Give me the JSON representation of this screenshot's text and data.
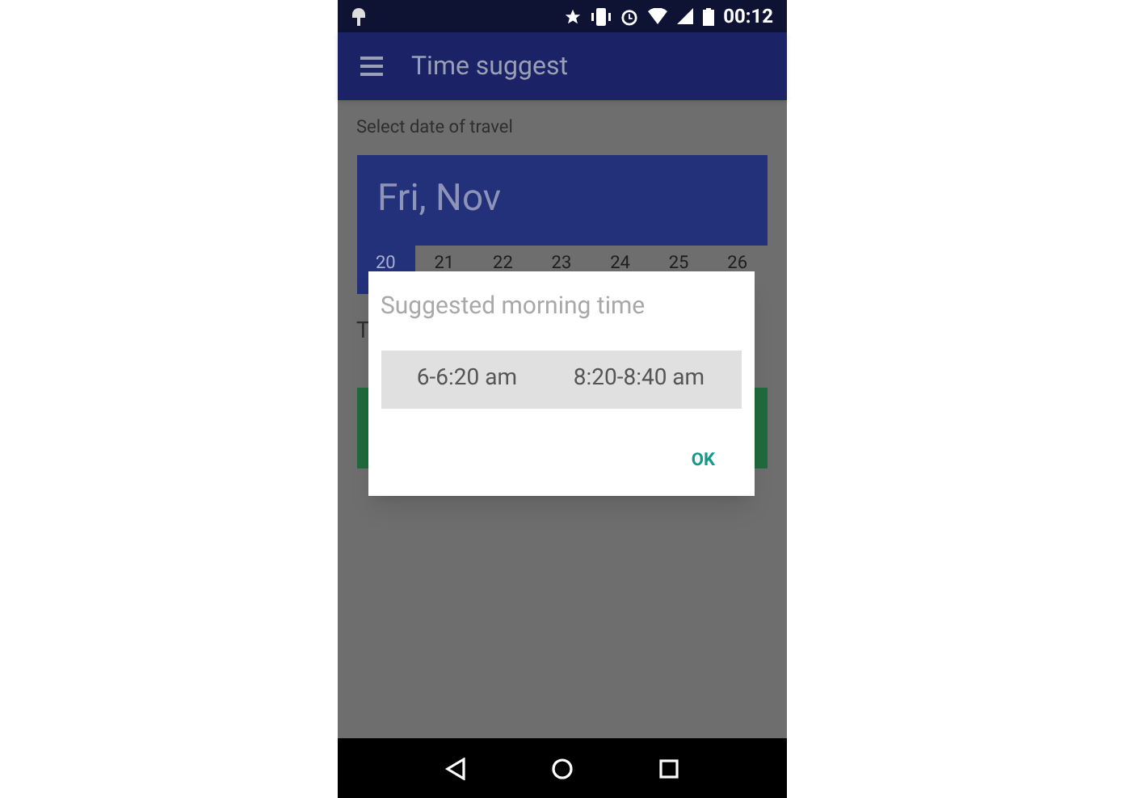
{
  "status_bar": {
    "time": "00:12"
  },
  "app_bar": {
    "title": "Time suggest"
  },
  "date_section": {
    "label": "Select date of travel",
    "header": "Fri, Nov",
    "days": [
      {
        "label": "20",
        "selected": true
      },
      {
        "label": "21",
        "selected": false
      },
      {
        "label": "22",
        "selected": false
      },
      {
        "label": "23",
        "selected": false
      },
      {
        "label": "24",
        "selected": false
      },
      {
        "label": "25",
        "selected": false
      },
      {
        "label": "26",
        "selected": false
      }
    ]
  },
  "hidden_label": "T",
  "dialog": {
    "title": "Suggested morning time",
    "times": [
      "6-6:20 am",
      "8:20-8:40 am"
    ],
    "button": "OK"
  }
}
